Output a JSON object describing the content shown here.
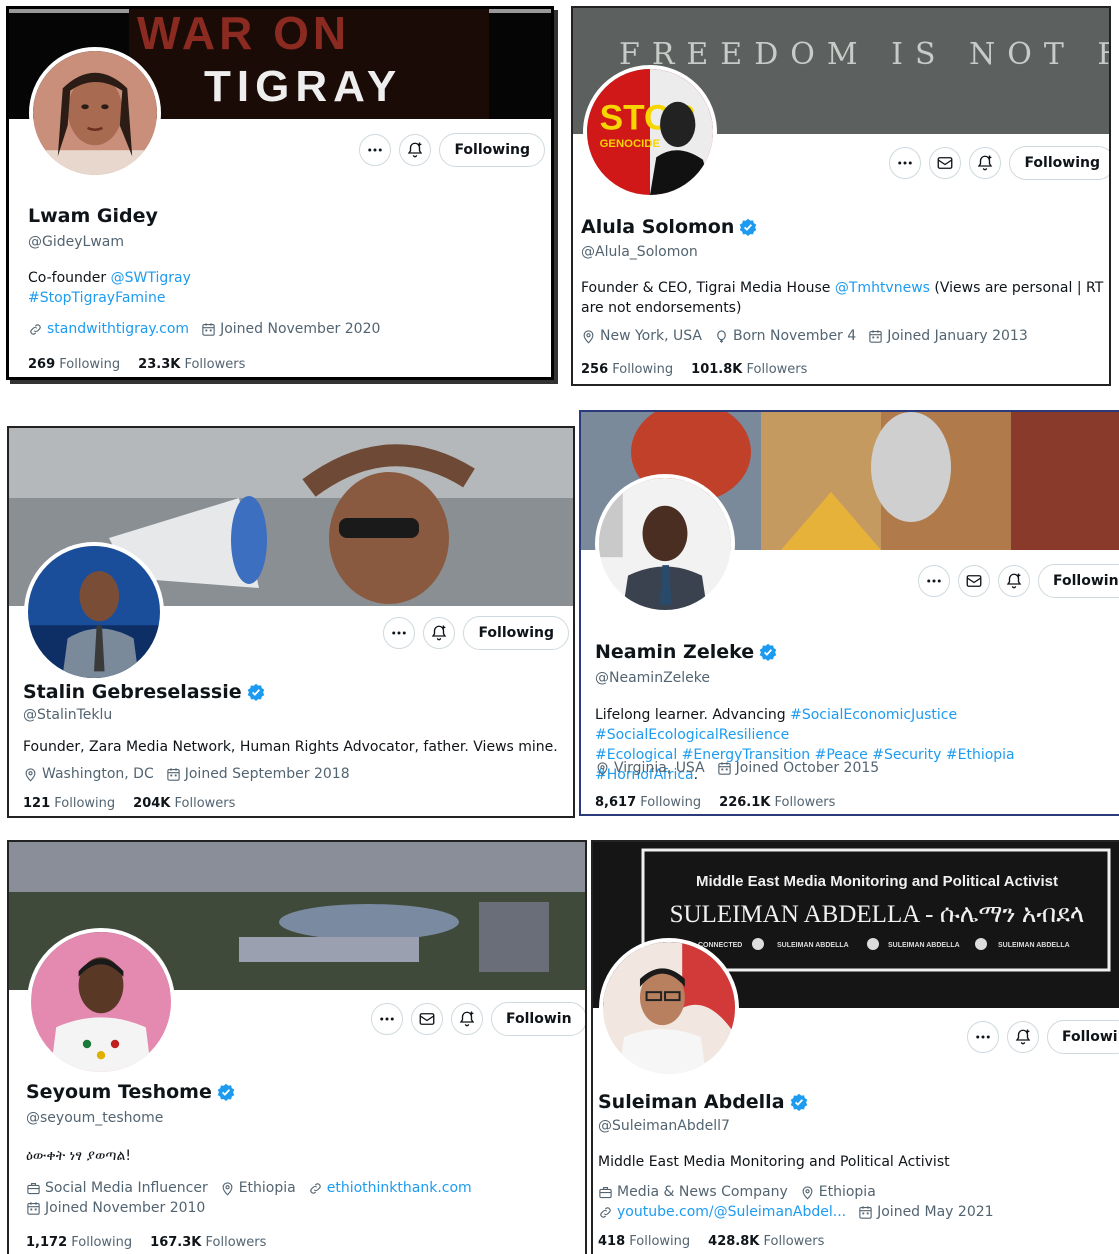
{
  "cards": [
    {
      "banner_text": "WAR ON",
      "banner_text2": "TIGRAY",
      "follow_label": "Following",
      "name": "Lwam Gidey",
      "handle": "@GideyLwam",
      "bio_text": "Co-founder ",
      "bio_link1": "@SWTigray",
      "bio_link2": "#StopTigrayFamine",
      "website": "standwithtigray.com",
      "joined": "Joined November 2020",
      "following_count": "269",
      "following_label": "Following",
      "followers_count": "23.3K",
      "followers_label": "Followers"
    },
    {
      "banner_text": "FREEDOM IS NOT FREE",
      "follow_label": "Following",
      "name": "Alula Solomon",
      "handle": "@Alula_Solomon",
      "bio_text": "Founder & CEO, Tigrai Media House ",
      "bio_link1": "@Tmhtvnews",
      "bio_text2": " (Views are personal | RT are not endorsements)",
      "location": "New York, USA",
      "born": "Born November 4",
      "joined": "Joined January 2013",
      "following_count": "256",
      "following_label": "Following",
      "followers_count": "101.8K",
      "followers_label": "Followers"
    },
    {
      "follow_label": "Following",
      "name": "Stalin Gebreselassie",
      "handle": "@StalinTeklu",
      "bio_text": "Founder, Zara Media Network, Human Rights Advocator, father. Views mine.",
      "location": "Washington, DC",
      "joined": "Joined September 2018",
      "following_count": "121",
      "following_label": "Following",
      "followers_count": "204K",
      "followers_label": "Followers"
    },
    {
      "follow_label": "Followin",
      "name": "Neamin Zeleke",
      "handle": "@NeaminZeleke",
      "bio_text": "Lifelong learner. Advancing ",
      "bio_link1": "#SocialEconomicJustice #SocialEcologicalResilience",
      "bio_link2": "#Ecological #EnergyTransition #Peace #Security #Ethiopia #HornofAfrica",
      "bio_text2": ".",
      "location": "Virginia, USA",
      "joined": "Joined October 2015",
      "following_count": "8,617",
      "following_label": "Following",
      "followers_count": "226.1K",
      "followers_label": "Followers"
    },
    {
      "follow_label": "Followin",
      "name": "Seyoum Teshome",
      "handle": "@seyoum_teshome",
      "bio_text": "ዕውቀት ነፃ ያወጣል!",
      "category": "Social Media Influencer",
      "location": "Ethiopia",
      "website": "ethiothinkthank.com",
      "joined": "Joined November 2010",
      "following_count": "1,172",
      "following_label": "Following",
      "followers_count": "167.3K",
      "followers_label": "Followers"
    },
    {
      "banner_line1": "Middle East Media Monitoring and Political Activist",
      "banner_line2": "SULEIMAN ABDELLA - ሱሌማን አብደላ",
      "banner_social_prefix": "CONNECTED",
      "banner_social1": "SULEIMAN ABDELLA",
      "banner_social2": "SULEIMAN ABDELLA",
      "banner_social3": "SULEIMAN ABDELLA",
      "follow_label": "Followi",
      "name": "Suleiman Abdella",
      "handle": "@SuleimanAbdell7",
      "bio_text": "Middle East Media Monitoring and Political Activist",
      "category": "Media & News Company",
      "location": "Ethiopia",
      "website": "youtube.com/@SuleimanAbdel...",
      "joined": "Joined May 2021",
      "following_count": "418",
      "following_label": "Following",
      "followers_count": "428.8K",
      "followers_label": "Followers"
    }
  ],
  "colors": {
    "link": "#1d9bf0",
    "verified": "#1d9bf0",
    "muted": "#536471",
    "border": "#cfd9de"
  }
}
